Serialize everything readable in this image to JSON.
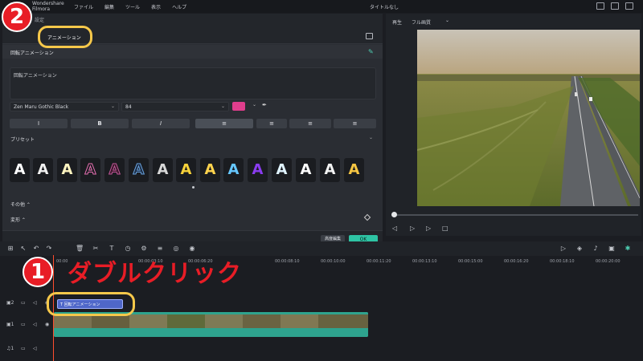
{
  "menubar": {
    "app_name": "Wondershare Filmora",
    "items": [
      "ファイル",
      "編集",
      "ツール",
      "表示",
      "ヘルプ"
    ],
    "doc_title": "タイトルなし"
  },
  "editor": {
    "tab_partial": "設定",
    "tab_animation": "アニメーション",
    "section_label": "回転アニメーション",
    "text_value": "回転アニメーション",
    "font_value": "Zen Maru Gothic Black",
    "size_value": "84",
    "text_color": "#e03e8d",
    "format_buttons": [
      "I",
      "B",
      "I",
      "≡",
      "≡",
      "≡",
      "≡"
    ],
    "preset_label": "プリセット",
    "preset_glyph": "A",
    "other_label": "その他",
    "transform_label": "変形",
    "advanced_button": "高度編集",
    "ok_button": "OK"
  },
  "preview": {
    "play_label": "再生",
    "quality_label": "フル画質"
  },
  "timeline": {
    "ruler_labels": [
      "00:00",
      "00:00:03:10",
      "00:00:06:20",
      "00:00:08:10",
      "00:00:10:00",
      "00:00:11:20",
      "00:00:13:10",
      "00:00:15:00",
      "00:00:16:20",
      "00:00:18:10",
      "00:00:20:00"
    ],
    "text_clip_label": "回転アニメーション",
    "track_labels": [
      "2",
      "1",
      "1"
    ]
  },
  "annotations": {
    "badge1": "1",
    "badge2": "2",
    "instruction": "ダブルクリック"
  }
}
